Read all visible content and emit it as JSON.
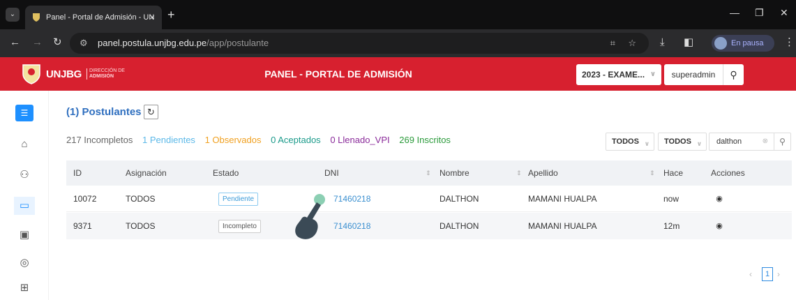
{
  "browser": {
    "tab_title": "Panel - Portal de Admisión - UN",
    "new_tab": "+",
    "url_host": "panel.postula.unjbg.edu.pe",
    "url_path": "/app/postulante",
    "profile_status": "En pausa"
  },
  "header": {
    "brand": "UNJBG",
    "brand_sub_1": "DIRECCIÓN DE",
    "brand_sub_2": "ADMISIÓN",
    "title": "PANEL - PORTAL DE ADMISIÓN",
    "year_select": "2023 - EXAME...",
    "username": "superadmin"
  },
  "page": {
    "title": "(1) Postulantes",
    "counters": [
      {
        "text": "217 Incompletos",
        "color": "#666666"
      },
      {
        "text": "1 Pendientes",
        "color": "#5bb8e8"
      },
      {
        "text": "1 Observados",
        "color": "#f0a020"
      },
      {
        "text": "0 Aceptados",
        "color": "#1a9a8a"
      },
      {
        "text": "0 Llenado_VPI",
        "color": "#8a2a9a"
      },
      {
        "text": "269 Inscritos",
        "color": "#2a9a3a"
      }
    ],
    "filter_1": "TODOS",
    "filter_2": "TODOS",
    "search_value": "dalthon"
  },
  "table": {
    "columns": [
      "ID",
      "Asignación",
      "Estado",
      "DNI",
      "Nombre",
      "Apellido",
      "Hace",
      "Acciones"
    ],
    "rows": [
      {
        "id": "10072",
        "asignacion": "TODOS",
        "estado": "Pendiente",
        "estado_color": "#5bb8e8",
        "dni": "71460218",
        "nombre": "DALTHON",
        "apellido": "MAMANI HUALPA",
        "hace": "now"
      },
      {
        "id": "9371",
        "asignacion": "TODOS",
        "estado": "Incompleto",
        "estado_color": "#888888",
        "dni": "71460218",
        "nombre": "DALTHON",
        "apellido": "MAMANI HUALPA",
        "hace": "12m"
      }
    ]
  },
  "pagination": {
    "current": "1"
  },
  "icons": [
    "menu-icon",
    "home-icon",
    "users-icon",
    "folder-icon",
    "monitor-icon",
    "watch-icon",
    "network-icon",
    "refresh-icon",
    "search-icon",
    "eye-icon",
    "user-icon"
  ],
  "colors": {
    "header_red": "#d7202f",
    "accent_blue": "#1e90ff"
  }
}
